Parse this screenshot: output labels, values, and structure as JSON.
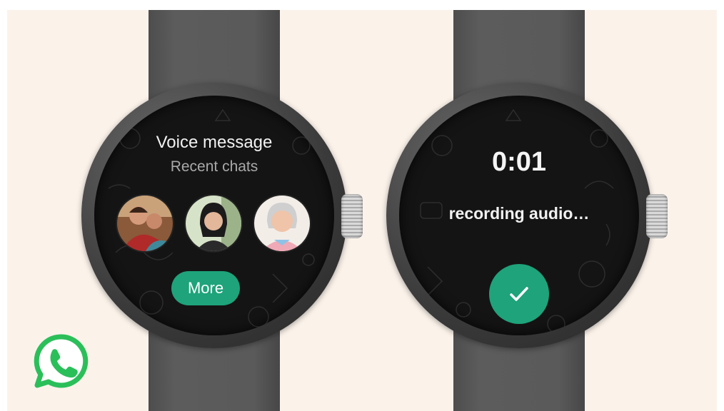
{
  "colors": {
    "background": "#fbf3ea",
    "accent": "#1ea37a",
    "screen": "#141414",
    "strap": "#555555"
  },
  "left_watch": {
    "title": "Voice message",
    "subtitle": "Recent chats",
    "contacts": [
      {
        "icon": "contact-avatar-couple"
      },
      {
        "icon": "contact-avatar-woman"
      },
      {
        "icon": "contact-avatar-older-woman"
      }
    ],
    "more_label": "More"
  },
  "right_watch": {
    "timer": "0:01",
    "status": "recording audio…",
    "confirm_icon": "checkmark-icon"
  },
  "brand": {
    "logo_icon": "whatsapp-logo-icon"
  }
}
